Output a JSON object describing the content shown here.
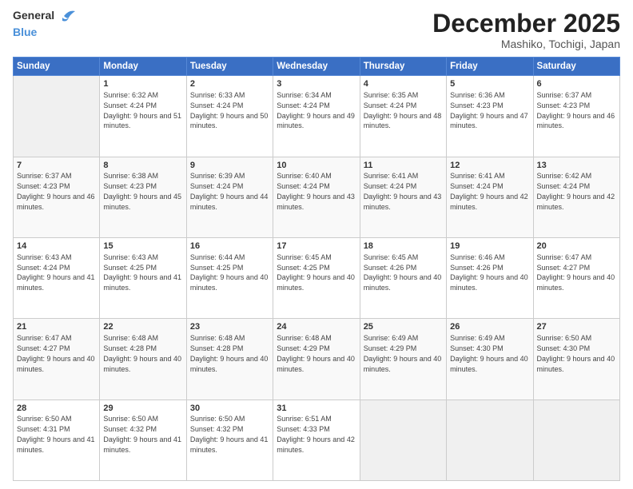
{
  "logo": {
    "text_general": "General",
    "text_blue": "Blue"
  },
  "title": {
    "month_year": "December 2025",
    "location": "Mashiko, Tochigi, Japan"
  },
  "weekdays": [
    "Sunday",
    "Monday",
    "Tuesday",
    "Wednesday",
    "Thursday",
    "Friday",
    "Saturday"
  ],
  "weeks": [
    [
      {
        "day": "",
        "sunrise": "",
        "sunset": "",
        "daylight": ""
      },
      {
        "day": "1",
        "sunrise": "Sunrise: 6:32 AM",
        "sunset": "Sunset: 4:24 PM",
        "daylight": "Daylight: 9 hours and 51 minutes."
      },
      {
        "day": "2",
        "sunrise": "Sunrise: 6:33 AM",
        "sunset": "Sunset: 4:24 PM",
        "daylight": "Daylight: 9 hours and 50 minutes."
      },
      {
        "day": "3",
        "sunrise": "Sunrise: 6:34 AM",
        "sunset": "Sunset: 4:24 PM",
        "daylight": "Daylight: 9 hours and 49 minutes."
      },
      {
        "day": "4",
        "sunrise": "Sunrise: 6:35 AM",
        "sunset": "Sunset: 4:24 PM",
        "daylight": "Daylight: 9 hours and 48 minutes."
      },
      {
        "day": "5",
        "sunrise": "Sunrise: 6:36 AM",
        "sunset": "Sunset: 4:23 PM",
        "daylight": "Daylight: 9 hours and 47 minutes."
      },
      {
        "day": "6",
        "sunrise": "Sunrise: 6:37 AM",
        "sunset": "Sunset: 4:23 PM",
        "daylight": "Daylight: 9 hours and 46 minutes."
      }
    ],
    [
      {
        "day": "7",
        "sunrise": "Sunrise: 6:37 AM",
        "sunset": "Sunset: 4:23 PM",
        "daylight": "Daylight: 9 hours and 46 minutes."
      },
      {
        "day": "8",
        "sunrise": "Sunrise: 6:38 AM",
        "sunset": "Sunset: 4:23 PM",
        "daylight": "Daylight: 9 hours and 45 minutes."
      },
      {
        "day": "9",
        "sunrise": "Sunrise: 6:39 AM",
        "sunset": "Sunset: 4:24 PM",
        "daylight": "Daylight: 9 hours and 44 minutes."
      },
      {
        "day": "10",
        "sunrise": "Sunrise: 6:40 AM",
        "sunset": "Sunset: 4:24 PM",
        "daylight": "Daylight: 9 hours and 43 minutes."
      },
      {
        "day": "11",
        "sunrise": "Sunrise: 6:41 AM",
        "sunset": "Sunset: 4:24 PM",
        "daylight": "Daylight: 9 hours and 43 minutes."
      },
      {
        "day": "12",
        "sunrise": "Sunrise: 6:41 AM",
        "sunset": "Sunset: 4:24 PM",
        "daylight": "Daylight: 9 hours and 42 minutes."
      },
      {
        "day": "13",
        "sunrise": "Sunrise: 6:42 AM",
        "sunset": "Sunset: 4:24 PM",
        "daylight": "Daylight: 9 hours and 42 minutes."
      }
    ],
    [
      {
        "day": "14",
        "sunrise": "Sunrise: 6:43 AM",
        "sunset": "Sunset: 4:24 PM",
        "daylight": "Daylight: 9 hours and 41 minutes."
      },
      {
        "day": "15",
        "sunrise": "Sunrise: 6:43 AM",
        "sunset": "Sunset: 4:25 PM",
        "daylight": "Daylight: 9 hours and 41 minutes."
      },
      {
        "day": "16",
        "sunrise": "Sunrise: 6:44 AM",
        "sunset": "Sunset: 4:25 PM",
        "daylight": "Daylight: 9 hours and 40 minutes."
      },
      {
        "day": "17",
        "sunrise": "Sunrise: 6:45 AM",
        "sunset": "Sunset: 4:25 PM",
        "daylight": "Daylight: 9 hours and 40 minutes."
      },
      {
        "day": "18",
        "sunrise": "Sunrise: 6:45 AM",
        "sunset": "Sunset: 4:26 PM",
        "daylight": "Daylight: 9 hours and 40 minutes."
      },
      {
        "day": "19",
        "sunrise": "Sunrise: 6:46 AM",
        "sunset": "Sunset: 4:26 PM",
        "daylight": "Daylight: 9 hours and 40 minutes."
      },
      {
        "day": "20",
        "sunrise": "Sunrise: 6:47 AM",
        "sunset": "Sunset: 4:27 PM",
        "daylight": "Daylight: 9 hours and 40 minutes."
      }
    ],
    [
      {
        "day": "21",
        "sunrise": "Sunrise: 6:47 AM",
        "sunset": "Sunset: 4:27 PM",
        "daylight": "Daylight: 9 hours and 40 minutes."
      },
      {
        "day": "22",
        "sunrise": "Sunrise: 6:48 AM",
        "sunset": "Sunset: 4:28 PM",
        "daylight": "Daylight: 9 hours and 40 minutes."
      },
      {
        "day": "23",
        "sunrise": "Sunrise: 6:48 AM",
        "sunset": "Sunset: 4:28 PM",
        "daylight": "Daylight: 9 hours and 40 minutes."
      },
      {
        "day": "24",
        "sunrise": "Sunrise: 6:48 AM",
        "sunset": "Sunset: 4:29 PM",
        "daylight": "Daylight: 9 hours and 40 minutes."
      },
      {
        "day": "25",
        "sunrise": "Sunrise: 6:49 AM",
        "sunset": "Sunset: 4:29 PM",
        "daylight": "Daylight: 9 hours and 40 minutes."
      },
      {
        "day": "26",
        "sunrise": "Sunrise: 6:49 AM",
        "sunset": "Sunset: 4:30 PM",
        "daylight": "Daylight: 9 hours and 40 minutes."
      },
      {
        "day": "27",
        "sunrise": "Sunrise: 6:50 AM",
        "sunset": "Sunset: 4:30 PM",
        "daylight": "Daylight: 9 hours and 40 minutes."
      }
    ],
    [
      {
        "day": "28",
        "sunrise": "Sunrise: 6:50 AM",
        "sunset": "Sunset: 4:31 PM",
        "daylight": "Daylight: 9 hours and 41 minutes."
      },
      {
        "day": "29",
        "sunrise": "Sunrise: 6:50 AM",
        "sunset": "Sunset: 4:32 PM",
        "daylight": "Daylight: 9 hours and 41 minutes."
      },
      {
        "day": "30",
        "sunrise": "Sunrise: 6:50 AM",
        "sunset": "Sunset: 4:32 PM",
        "daylight": "Daylight: 9 hours and 41 minutes."
      },
      {
        "day": "31",
        "sunrise": "Sunrise: 6:51 AM",
        "sunset": "Sunset: 4:33 PM",
        "daylight": "Daylight: 9 hours and 42 minutes."
      },
      {
        "day": "",
        "sunrise": "",
        "sunset": "",
        "daylight": ""
      },
      {
        "day": "",
        "sunrise": "",
        "sunset": "",
        "daylight": ""
      },
      {
        "day": "",
        "sunrise": "",
        "sunset": "",
        "daylight": ""
      }
    ]
  ]
}
